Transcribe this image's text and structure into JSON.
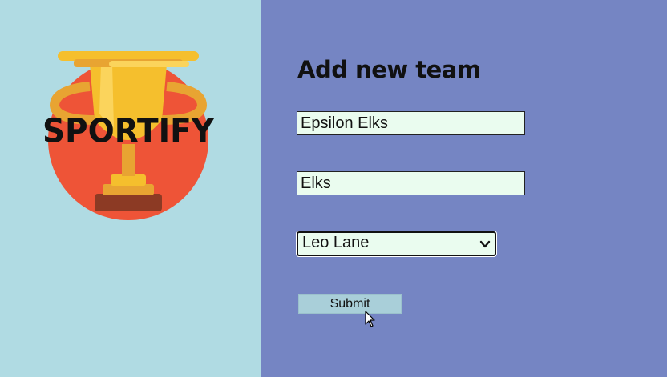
{
  "brand": {
    "logo_text": "SPORTIFY",
    "logo_icon": "trophy-icon"
  },
  "form": {
    "title": "Add new team",
    "team_name_value": "Epsilon Elks",
    "team_short_value": "Elks",
    "owner_selected": "Leo Lane",
    "submit_label": "Submit"
  },
  "colors": {
    "left_panel": "#b0dbe3",
    "right_panel": "#7585c3",
    "input_background": "#eafcef",
    "button_background": "#a9cfd9",
    "trophy_gold": "#f5bf2d",
    "circle_red": "#ee5437"
  }
}
